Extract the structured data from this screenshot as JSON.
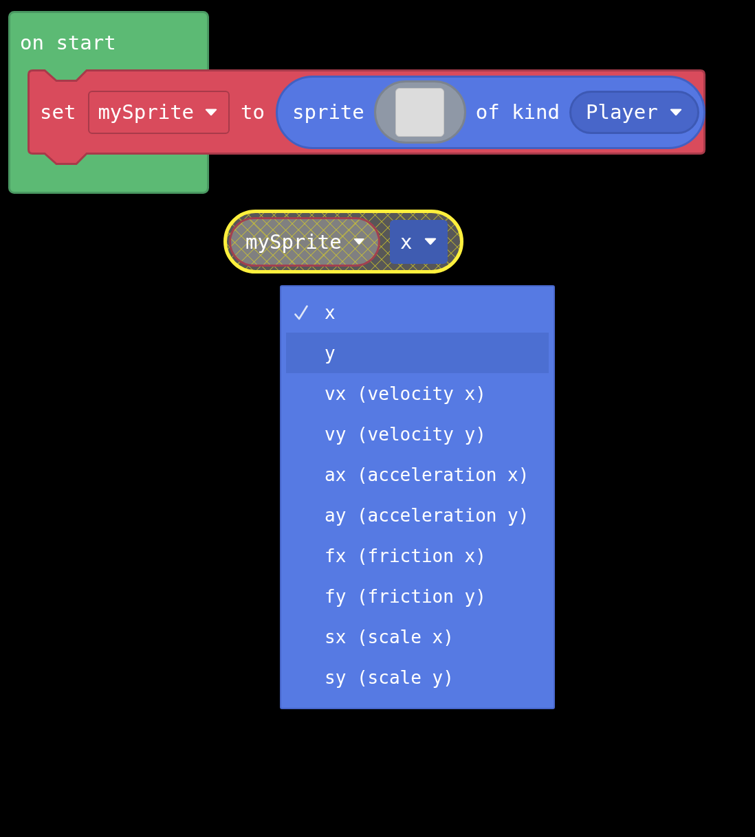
{
  "on_start_block": {
    "label": "on start"
  },
  "set_block": {
    "label": "set",
    "variable": {
      "value": "mySprite"
    },
    "connector_label": "to",
    "sprite_block": {
      "label": "sprite",
      "kind_label": "of kind",
      "kind": {
        "value": "Player"
      }
    }
  },
  "property_block": {
    "selected": true,
    "disabled": true,
    "variable": {
      "value": "mySprite"
    },
    "property": {
      "value": "x"
    }
  },
  "dropdown_menu": {
    "items": [
      {
        "label": "x",
        "selected": true,
        "highlighted": false
      },
      {
        "label": "y",
        "selected": false,
        "highlighted": true
      },
      {
        "label": "vx (velocity x)",
        "selected": false,
        "highlighted": false
      },
      {
        "label": "vy (velocity y)",
        "selected": false,
        "highlighted": false
      },
      {
        "label": "ax (acceleration x)",
        "selected": false,
        "highlighted": false
      },
      {
        "label": "ay (acceleration y)",
        "selected": false,
        "highlighted": false
      },
      {
        "label": "fx (friction x)",
        "selected": false,
        "highlighted": false
      },
      {
        "label": "fy (friction y)",
        "selected": false,
        "highlighted": false
      },
      {
        "label": "sx (scale x)",
        "selected": false,
        "highlighted": false
      },
      {
        "label": "sy (scale y)",
        "selected": false,
        "highlighted": false
      }
    ]
  }
}
